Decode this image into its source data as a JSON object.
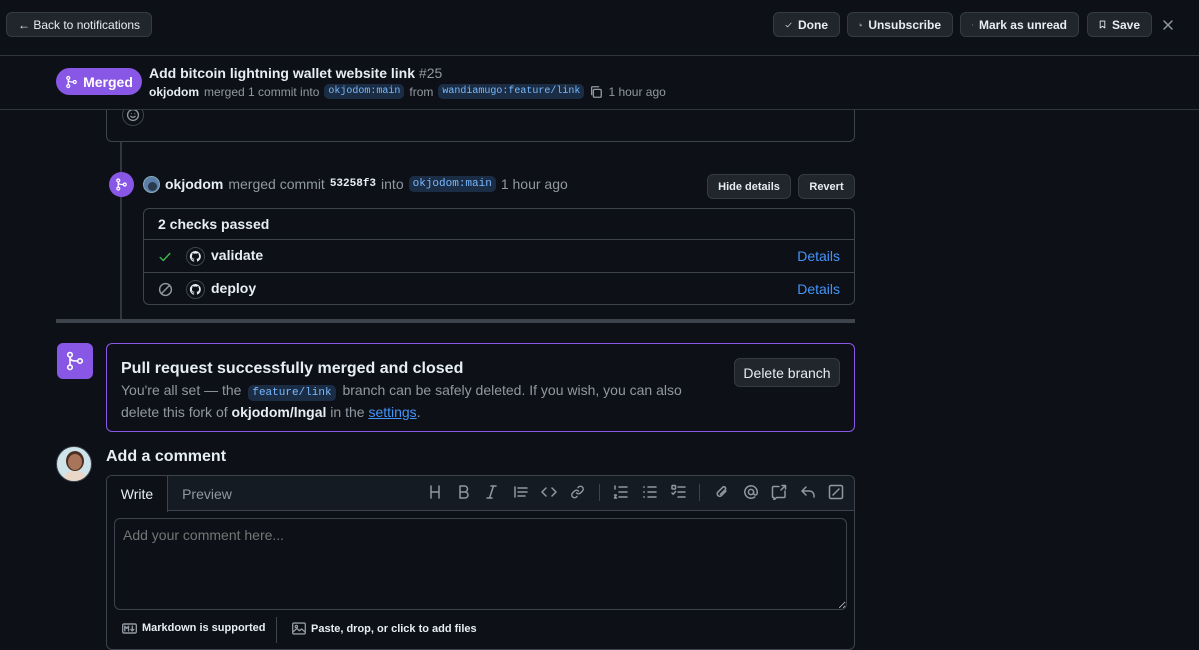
{
  "topbar": {
    "back_label": "← Back to notifications",
    "done_label": "Done",
    "unsubscribe_label": "Unsubscribe",
    "mark_unread_label": "Mark as unread",
    "save_label": "Save"
  },
  "pr_header": {
    "state_label": "Merged",
    "title": "Add bitcoin lightning wallet website link",
    "number": "#25",
    "author": "okjodom",
    "merged_text": "merged 1 commit into",
    "base_branch": "okjodom:main",
    "from_text": "from",
    "head_branch": "wandiamugo:feature/link",
    "time": "1 hour ago"
  },
  "merge_event": {
    "author": "okjodom",
    "merged_commit_text": "merged commit",
    "commit_sha": "53258f3",
    "into_text": "into",
    "branch": "okjodom:main",
    "time": "1 hour ago",
    "hide_details_label": "Hide details",
    "revert_label": "Revert"
  },
  "checks": {
    "summary": "2 checks passed",
    "items": [
      {
        "name": "validate",
        "status": "success",
        "details_label": "Details"
      },
      {
        "name": "deploy",
        "status": "skipped",
        "details_label": "Details"
      }
    ]
  },
  "merged_box": {
    "title": "Pull request successfully merged and closed",
    "text_before_branch": "You're all set — the",
    "branch": "feature/link",
    "text_after_branch": "branch can be safely deleted. If you wish, you can also delete this",
    "text_fork_prefix": "fork of",
    "repo": "okjodom/lngal",
    "text_in_the": "in the",
    "settings_link": "settings",
    "period": ".",
    "delete_branch_label": "Delete branch"
  },
  "comment": {
    "heading": "Add a comment",
    "tab_write": "Write",
    "tab_preview": "Preview",
    "placeholder": "Add your comment here...",
    "markdown_note": "Markdown is supported",
    "attach_note": "Paste, drop, or click to add files"
  },
  "colors": {
    "background": "#0d1117",
    "merged_purple": "#8957e5",
    "link_blue": "#4493f8",
    "success_green": "#3fb950",
    "border": "#30363d"
  },
  "icons": [
    "arrow-left-icon",
    "check-icon",
    "bell-slash-icon",
    "dot-icon",
    "bookmark-icon",
    "close-icon",
    "git-merge-icon",
    "copy-icon",
    "smiley-icon",
    "github-mark-icon",
    "skip-icon",
    "heading-icon",
    "bold-icon",
    "italic-icon",
    "quote-icon",
    "code-icon",
    "link-icon",
    "ordered-list-icon",
    "unordered-list-icon",
    "tasklist-icon",
    "paperclip-icon",
    "mention-icon",
    "cross-reference-icon",
    "reply-icon",
    "diff-icon",
    "markdown-icon",
    "image-icon"
  ]
}
